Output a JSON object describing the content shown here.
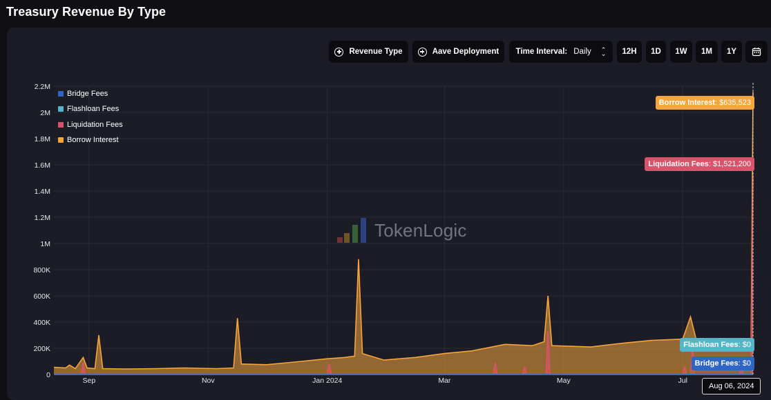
{
  "page": {
    "title": "Treasury Revenue By Type"
  },
  "toolbar": {
    "revenue_type_label": "Revenue Type",
    "aave_deployment_label": "Aave Deployment",
    "time_interval_label": "Time Interval:",
    "time_interval_value": "Daily",
    "ranges": [
      "12H",
      "1D",
      "1W",
      "1M",
      "1Y"
    ]
  },
  "watermark": {
    "text": "TokenLogic"
  },
  "tooltip": {
    "date": "Aug 06, 2024",
    "borrow_interest": {
      "name": "Borrow Interest",
      "value": "$635,523"
    },
    "liquidation_fees": {
      "name": "Liquidation Fees",
      "value": "$1,521,200"
    },
    "flashloan_fees": {
      "name": "Flashloan Fees",
      "value": "$0"
    },
    "bridge_fees": {
      "name": "Bridge Fees",
      "value": "$0"
    }
  },
  "colors": {
    "borrow_interest": "#f5a53e",
    "liquidation_fees": "#d9546b",
    "flashloan_fees": "#56b6c8",
    "bridge_fees": "#2f66c4",
    "panel": "#1c1c26"
  },
  "chart_data": {
    "type": "area",
    "stacked": true,
    "title": "Treasury Revenue By Type",
    "x_axis": {
      "ticks": [
        "Sep",
        "Nov",
        "Jan 2024",
        "Mar",
        "May",
        "Jul"
      ],
      "range": [
        "2023-08-14",
        "2024-08-06"
      ]
    },
    "y_axis": {
      "ticks": [
        "0",
        "200K",
        "400K",
        "600K",
        "800K",
        "1M",
        "1.2M",
        "1.4M",
        "1.6M",
        "1.8M",
        "2M",
        "2.2M"
      ],
      "range": [
        0,
        2200000
      ]
    },
    "grid": true,
    "legend_position": "top-left",
    "legend": [
      "Bridge Fees",
      "Flashloan Fees",
      "Liquidation Fees",
      "Borrow Interest"
    ],
    "series": [
      {
        "name": "Borrow Interest",
        "color": "#f5a53e",
        "points": [
          [
            "2023-08-14",
            55000
          ],
          [
            "2023-08-20",
            50000
          ],
          [
            "2023-08-22",
            72000
          ],
          [
            "2023-08-25",
            45000
          ],
          [
            "2023-08-29",
            130000
          ],
          [
            "2023-08-31",
            50000
          ],
          [
            "2023-09-04",
            45000
          ],
          [
            "2023-09-06",
            300000
          ],
          [
            "2023-09-08",
            45000
          ],
          [
            "2023-09-20",
            42000
          ],
          [
            "2023-10-05",
            45000
          ],
          [
            "2023-10-20",
            50000
          ],
          [
            "2023-11-05",
            45000
          ],
          [
            "2023-11-14",
            50000
          ],
          [
            "2023-11-16",
            430000
          ],
          [
            "2023-11-18",
            80000
          ],
          [
            "2023-12-01",
            75000
          ],
          [
            "2023-12-15",
            95000
          ],
          [
            "2024-01-01",
            120000
          ],
          [
            "2024-01-10",
            130000
          ],
          [
            "2024-01-15",
            140000
          ],
          [
            "2024-01-17",
            880000
          ],
          [
            "2024-01-19",
            160000
          ],
          [
            "2024-01-30",
            110000
          ],
          [
            "2024-02-15",
            130000
          ],
          [
            "2024-03-01",
            160000
          ],
          [
            "2024-03-15",
            180000
          ],
          [
            "2024-04-01",
            230000
          ],
          [
            "2024-04-15",
            220000
          ],
          [
            "2024-04-21",
            250000
          ],
          [
            "2024-04-23",
            600000
          ],
          [
            "2024-04-25",
            220000
          ],
          [
            "2024-05-15",
            210000
          ],
          [
            "2024-06-01",
            240000
          ],
          [
            "2024-06-15",
            260000
          ],
          [
            "2024-07-01",
            270000
          ],
          [
            "2024-07-05",
            440000
          ],
          [
            "2024-07-08",
            260000
          ],
          [
            "2024-07-25",
            270000
          ],
          [
            "2024-08-05",
            250000
          ],
          [
            "2024-08-06",
            2156723
          ]
        ]
      },
      {
        "name": "Liquidation Fees",
        "color": "#d9546b",
        "points": [
          [
            "2023-08-14",
            0
          ],
          [
            "2023-08-28",
            0
          ],
          [
            "2023-08-29",
            90000
          ],
          [
            "2023-08-30",
            0
          ],
          [
            "2024-01-01",
            0
          ],
          [
            "2024-01-02",
            80000
          ],
          [
            "2024-01-03",
            0
          ],
          [
            "2024-03-26",
            0
          ],
          [
            "2024-03-27",
            90000
          ],
          [
            "2024-03-28",
            0
          ],
          [
            "2024-04-10",
            0
          ],
          [
            "2024-04-11",
            60000
          ],
          [
            "2024-04-12",
            0
          ],
          [
            "2024-04-22",
            0
          ],
          [
            "2024-04-23",
            330000
          ],
          [
            "2024-04-24",
            0
          ],
          [
            "2024-07-01",
            0
          ],
          [
            "2024-07-02",
            60000
          ],
          [
            "2024-07-03",
            0
          ],
          [
            "2024-07-05",
            0
          ],
          [
            "2024-07-06",
            200000
          ],
          [
            "2024-07-07",
            0
          ],
          [
            "2024-07-30",
            0
          ],
          [
            "2024-07-31",
            60000
          ],
          [
            "2024-08-01",
            0
          ],
          [
            "2024-08-05",
            0
          ],
          [
            "2024-08-06",
            1521200
          ]
        ]
      },
      {
        "name": "Flashloan Fees",
        "color": "#56b6c8",
        "points": [
          [
            "2023-08-14",
            0
          ],
          [
            "2024-08-06",
            0
          ]
        ]
      },
      {
        "name": "Bridge Fees",
        "color": "#2f66c4",
        "points": [
          [
            "2023-08-14",
            0
          ],
          [
            "2024-08-06",
            0
          ]
        ]
      }
    ]
  }
}
